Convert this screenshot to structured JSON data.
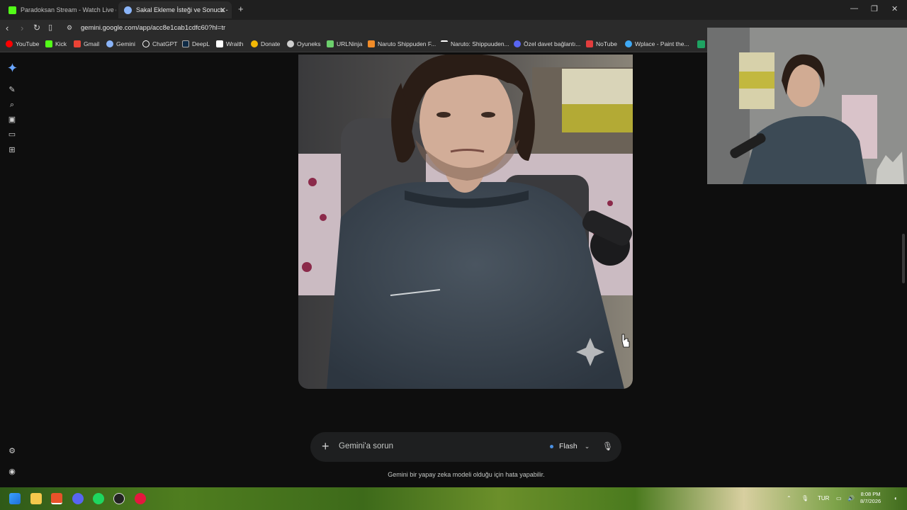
{
  "browser": {
    "tabs": [
      {
        "label": "Paradoksan Stream - Watch Live on K",
        "active": false
      },
      {
        "label": "Sakal Ekleme İsteği ve Sonucu - ",
        "active": true
      }
    ],
    "new_tab": "+",
    "url": "gemini.google.com/app/acc8e1cab1cdfc60?hl=tr",
    "bookmarks": [
      {
        "label": "YouTube",
        "color": "#ff0000"
      },
      {
        "label": "Kick",
        "color": "#53fc18"
      },
      {
        "label": "Gmail",
        "color": "#ea4335"
      },
      {
        "label": "Gemini",
        "color": "#8ab4f8"
      },
      {
        "label": "ChatGPT",
        "color": "#ffffff"
      },
      {
        "label": "DeepL",
        "color": "#0f2b46"
      },
      {
        "label": "Wraith",
        "color": "#ffffff"
      },
      {
        "label": "Donate",
        "color": "#f2b705"
      },
      {
        "label": "Oyuneks",
        "color": "#cfcfcf"
      },
      {
        "label": "URLNinja",
        "color": "#6ccf6c"
      },
      {
        "label": "Naruto Shippuden F...",
        "color": "#f28c28"
      },
      {
        "label": "Naruto: Shippuuden...",
        "color": "#ffffff"
      },
      {
        "label": "Özel davet bağlantı...",
        "color": "#5865f2"
      },
      {
        "label": "NoTube",
        "color": "#e23d3d"
      },
      {
        "label": "Wplace - Paint the...",
        "color": "#3fa9f5"
      }
    ]
  },
  "gemini": {
    "prompt_placeholder": "Gemini'a sorun",
    "model_label": "Flash",
    "disclaimer": "Gemini bir yapay zeka modeli olduğu için hata yapabilir."
  },
  "taskbar": {
    "language": "TUR",
    "time": "8:08 PM",
    "date": "8/7/2026"
  }
}
